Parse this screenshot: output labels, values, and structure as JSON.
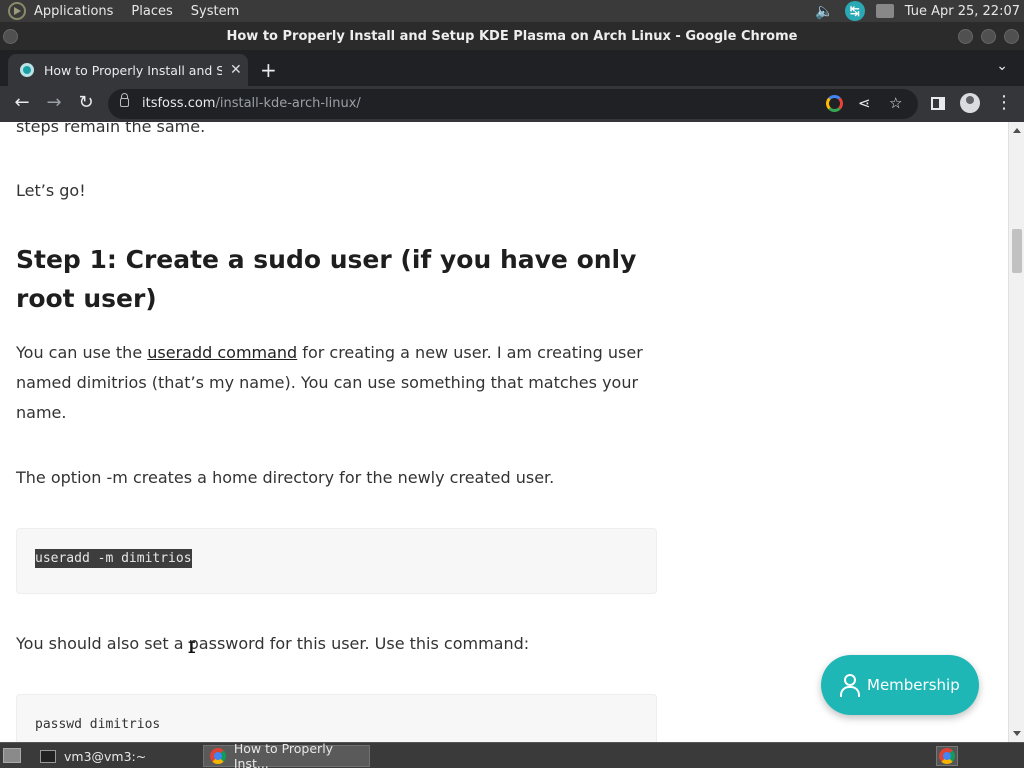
{
  "top_panel": {
    "menus": [
      "Applications",
      "Places",
      "System"
    ],
    "clock": "Tue Apr 25, 22:07"
  },
  "window": {
    "title": "How to Properly Install and Setup KDE Plasma on Arch Linux - Google Chrome"
  },
  "tab": {
    "title": "How to Properly Install and Setup KDE Plasma on Arch Linux"
  },
  "address_bar": {
    "domain": "itsfoss.com",
    "path": "/install-kde-arch-linux/"
  },
  "article": {
    "partial_line": "steps remain the same.",
    "lets_go": "Let’s go!",
    "heading": "Step 1: Create a sudo user (if you have only root user)",
    "para1_before_link": "You can use the ",
    "para1_link": "useradd command",
    "para1_after_link": " for creating a new user. I am creating user named dimitrios (that’s my name). You can use something that matches your name.",
    "para2": "The option -m creates a home directory for the newly created user.",
    "code1": "useradd -m dimitrios",
    "para3": "You should also set a password for this user. Use this command:",
    "code2": "passwd dimitrios"
  },
  "membership_button": {
    "label": "Membership",
    "color": "#1fb6b6"
  },
  "taskbar": {
    "items": [
      "vm3@vm3:~",
      "How to Properly Inst..."
    ]
  }
}
